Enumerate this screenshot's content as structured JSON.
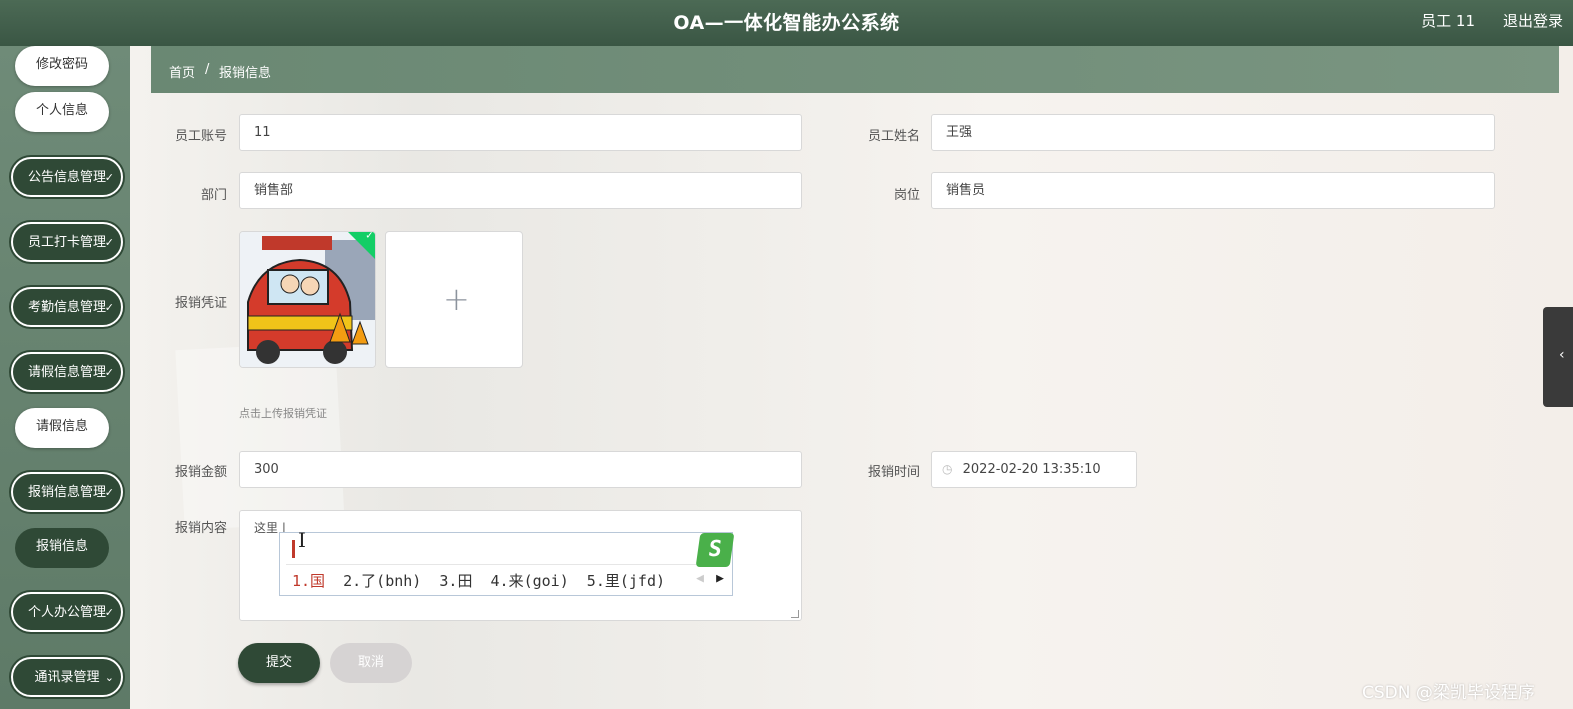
{
  "header": {
    "title": "OA—一体化智能办公系统",
    "user": "员工 11",
    "logout": "退出登录"
  },
  "sidebar": {
    "items": [
      {
        "label": "修改密码",
        "style": "white"
      },
      {
        "label": "个人信息",
        "style": "white"
      },
      {
        "label": "公告信息管理",
        "style": "dark"
      },
      {
        "label": "员工打卡管理",
        "style": "dark"
      },
      {
        "label": "考勤信息管理",
        "style": "dark"
      },
      {
        "label": "请假信息管理",
        "style": "dark"
      },
      {
        "label": "请假信息",
        "style": "white"
      },
      {
        "label": "报销信息管理",
        "style": "dark"
      },
      {
        "label": "报销信息",
        "style": "active"
      },
      {
        "label": "个人办公管理",
        "style": "dark"
      },
      {
        "label": "通讯录管理",
        "style": "dark"
      }
    ]
  },
  "breadcrumb": {
    "home": "首页",
    "sep": "/",
    "current": "报销信息"
  },
  "form": {
    "account_label": "员工账号",
    "account_value": "11",
    "name_label": "员工姓名",
    "name_value": "王强",
    "dept_label": "部门",
    "dept_value": "销售部",
    "post_label": "岗位",
    "post_value": "销售员",
    "voucher_label": "报销凭证",
    "voucher_hint": "点击上传报销凭证",
    "amount_label": "报销金额",
    "amount_value": "300",
    "time_label": "报销时间",
    "time_value": "2022-02-20 13:35:10",
    "content_label": "报销内容",
    "content_value": "这里 |",
    "submit": "提交",
    "cancel": "取消"
  },
  "ime": {
    "candidates_first": "1.国",
    "candidates_rest": "  2.了(bnh)  3.田  4.来(goi)  5.里(jfd)",
    "logo": "S"
  },
  "watermark": "CSDN @梁凯毕设程序",
  "colors": {
    "primary": "#2f4936",
    "header": "#3a5644",
    "success": "#13ce66"
  }
}
